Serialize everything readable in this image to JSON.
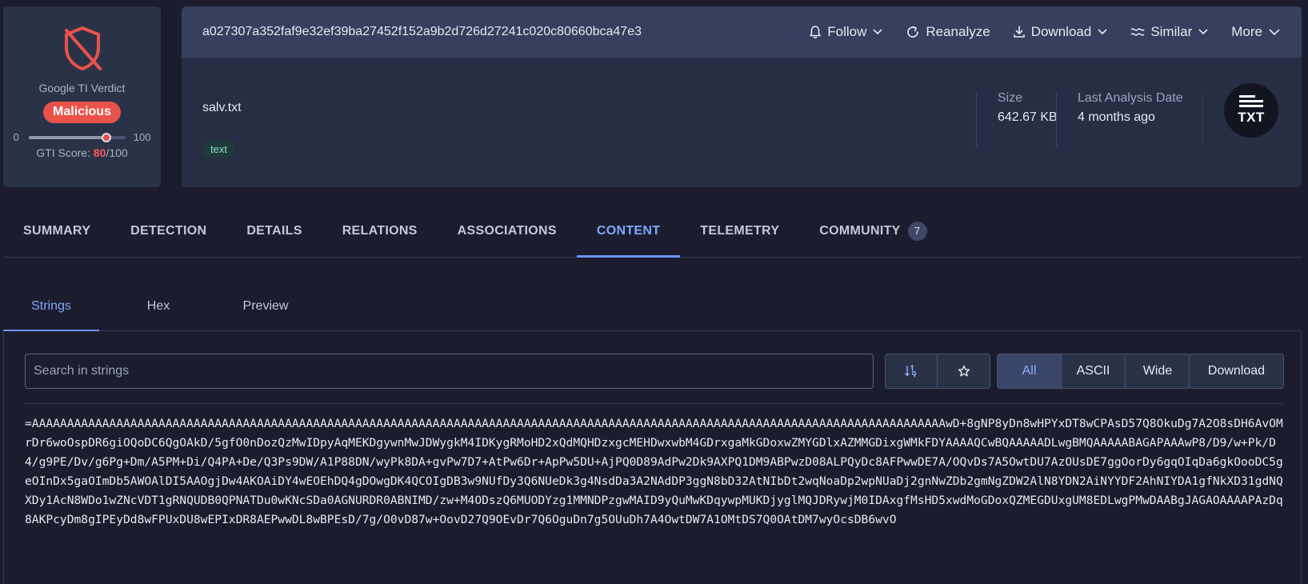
{
  "verdict": {
    "title": "Google TI Verdict",
    "badge": "Malicious",
    "scale_min": "0",
    "scale_max": "100",
    "score_label": "GTI Score: ",
    "score_value": "80",
    "score_suffix": "/100",
    "score_fraction": 0.8,
    "badge_color": "#e9524a"
  },
  "header": {
    "hash": "a027307a352faf9e32ef39ba27452f152a9b2d726d27241c020c80660bca47e3",
    "actions": {
      "follow": "Follow",
      "reanalyze": "Reanalyze",
      "download": "Download",
      "similar": "Similar",
      "more": "More"
    },
    "file_name": "salv.txt",
    "tag": "text",
    "size_label": "Size",
    "size_value": "642.67 KB",
    "date_label": "Last Analysis Date",
    "date_value": "4 months ago",
    "file_type_icon": "TXT"
  },
  "tabs": {
    "summary": "SUMMARY",
    "detection": "DETECTION",
    "details": "DETAILS",
    "relations": "RELATIONS",
    "associations": "ASSOCIATIONS",
    "content": "CONTENT",
    "telemetry": "TELEMETRY",
    "community": "COMMUNITY",
    "community_count": "7",
    "active": "CONTENT"
  },
  "subtabs": {
    "strings": "Strings",
    "hex": "Hex",
    "preview": "Preview",
    "active": "Strings"
  },
  "toolbar": {
    "search_placeholder": "Search in strings",
    "filter_all": "All",
    "filter_ascii": "ASCII",
    "filter_wide": "Wide",
    "download": "Download"
  },
  "strings_content": "=AAAAAAAAAAAAAAAAAAAAAAAAAAAAAAAAAAAAAAAAAAAAAAAAAAAAAAAAAAAAAAAAAAAAAAAAAAAAAAAAAAAAAAAAAAAAAAAAAAAAAAAAAAAAAAAAAAAAAAAAAAAAAAAAAAwD+8gNP8yDn8wHPYxDT8wCPAsD57Q8OkuDg7A2O8sDH6AvOMrDr6woOspDR6giOQoDC6QgOAkD/5gfO0nDozQzMwIDpyAqMEKDgywnMwJDWygkM4IDKygRMoHD2xQdMQHDzxgcMEHDwxwbM4GDrxgaMkGDoxwZMYGDlxAZMMGDixgWMkFDYAAAAQCwBQAAAAADLwgBMQAAAAABAGAPAAAwP8/D9/w+Pk/D4/g9PE/Dv/g6Pg+Dm/A5PM+Di/Q4PA+De/Q3Ps9DW/A1P88DN/wyPk8DA+gvPw7D7+AtPw6Dr+ApPw5DU+AjPQ0D89AdPw2Dk9AXPQ1DM9ABPwzD08ALPQyDc8AFPwwDE7A/OQvDs7A5OwtDU7AzOUsDE7ggOorDy6gqOIqDa6gkOooDC5geOInDx5gaOImDb5AWOAlDI5AAOgjDw4AKOAiDY4wEOEhDQ4gDOwgDK4QCOIgDB3w9NUfDy3Q6NUeDk3g4NsdDa3A2NAdDP3ggN8bD32AtNIbDt2wqNoaDp2wpNUaDj2gnNwZDb2gmNgZDW2AlN8YDN2AiNYYDF2AhNIYDA1gfNkXD31gdNQXDy1AcN8WDo1wZNcVDT1gRNQUDB0QPNATDu0wKNcSDa0AGNURDR0ABNIMD/zw+M4ODszQ6MUODYzg1MMNDPzgwMAID9yQuMwKDqywpMUKDjyglMQJDRywjM0IDAxgfMsHD5xwdMoGDoxQZMEGDUxgUM8EDLwgPMwDAABgJAGAOAAAAPAzDq8AKPcyDm8gIPEyDd8wFPUxDU8wEPIxDR8AEPwwDL8wBPEsD/7g/O0vD87w+OovD27Q9OEvDr7Q6OguDn7g5OUuDh7A4OwtDW7A1OMtDS7Q0OAtDM7wyOcsDB6wvO",
  "colors": {
    "accent": "#7fa8ff",
    "malicious": "#e9524a",
    "background": "#1b1d2e",
    "card": "#262d44",
    "hash_bar": "#34405d"
  }
}
